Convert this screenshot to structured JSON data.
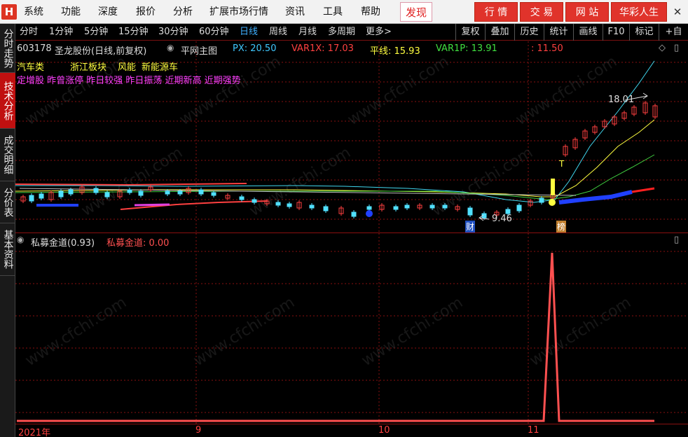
{
  "menu": {
    "logo": "H",
    "items": [
      "系统",
      "功能",
      "深度",
      "报价",
      "分析",
      "扩展市场行情",
      "资讯",
      "工具",
      "帮助"
    ],
    "discover": "发现",
    "red_buttons": [
      "行 情",
      "交 易",
      "网 站",
      "华彩人生"
    ],
    "window_controls": [
      "—",
      "✕"
    ]
  },
  "sidetabs": [
    "分时走势",
    "技术分析",
    "成交明细",
    "分价表",
    "基本资料"
  ],
  "periods": [
    "分时",
    "1分钟",
    "5分钟",
    "15分钟",
    "30分钟",
    "60分钟",
    "日线",
    "周线",
    "月线",
    "多周期",
    "更多>"
  ],
  "active_period": "日线",
  "right_tools": [
    "复权",
    "叠加",
    "历史",
    "统计",
    "画线",
    "F10",
    "标记",
    "+自"
  ],
  "main": {
    "stock_code": "603178",
    "stock_name": "圣龙股份(日线,前复权)",
    "indicator_name": "平网主图",
    "readouts": [
      {
        "label": "PX: 20.50",
        "color": "#3fc8ff"
      },
      {
        "label": "VAR1X: 17.03",
        "color": "#ff4040"
      },
      {
        "label": "平线: 15.93",
        "color": "#ffff40"
      },
      {
        "label": "VAR1P: 13.91",
        "color": "#40e040"
      },
      {
        "label": ": 11.50",
        "color": "#ff4040"
      }
    ],
    "tags_line1": [
      {
        "text": "汽车类",
        "color": "#ffff40"
      },
      {
        "text": "浙江板块",
        "color": "#ffff40"
      },
      {
        "text": "风能",
        "color": "#ffff40"
      },
      {
        "text": "新能源车",
        "color": "#ffff40"
      }
    ],
    "tags_line2": "定增股 昨曾涨停 昨日较强 昨日振荡 近期新高 近期强势",
    "high_label": "18.01",
    "low_label": "9.46",
    "badge_cai": "财",
    "badge_bang": "榜",
    "t_marker": "T"
  },
  "sub": {
    "indicator": "私募金道(0.93)",
    "value_label": "私募金道: 0.00"
  },
  "axis": {
    "labels": [
      "2021年",
      "9",
      "10",
      "11"
    ]
  },
  "watermark": "www.cfchi.com",
  "colors": {
    "grid_red": "#8a1010",
    "up": "#ff4040",
    "down": "#50e0ff",
    "accent": "#e0332b"
  }
}
